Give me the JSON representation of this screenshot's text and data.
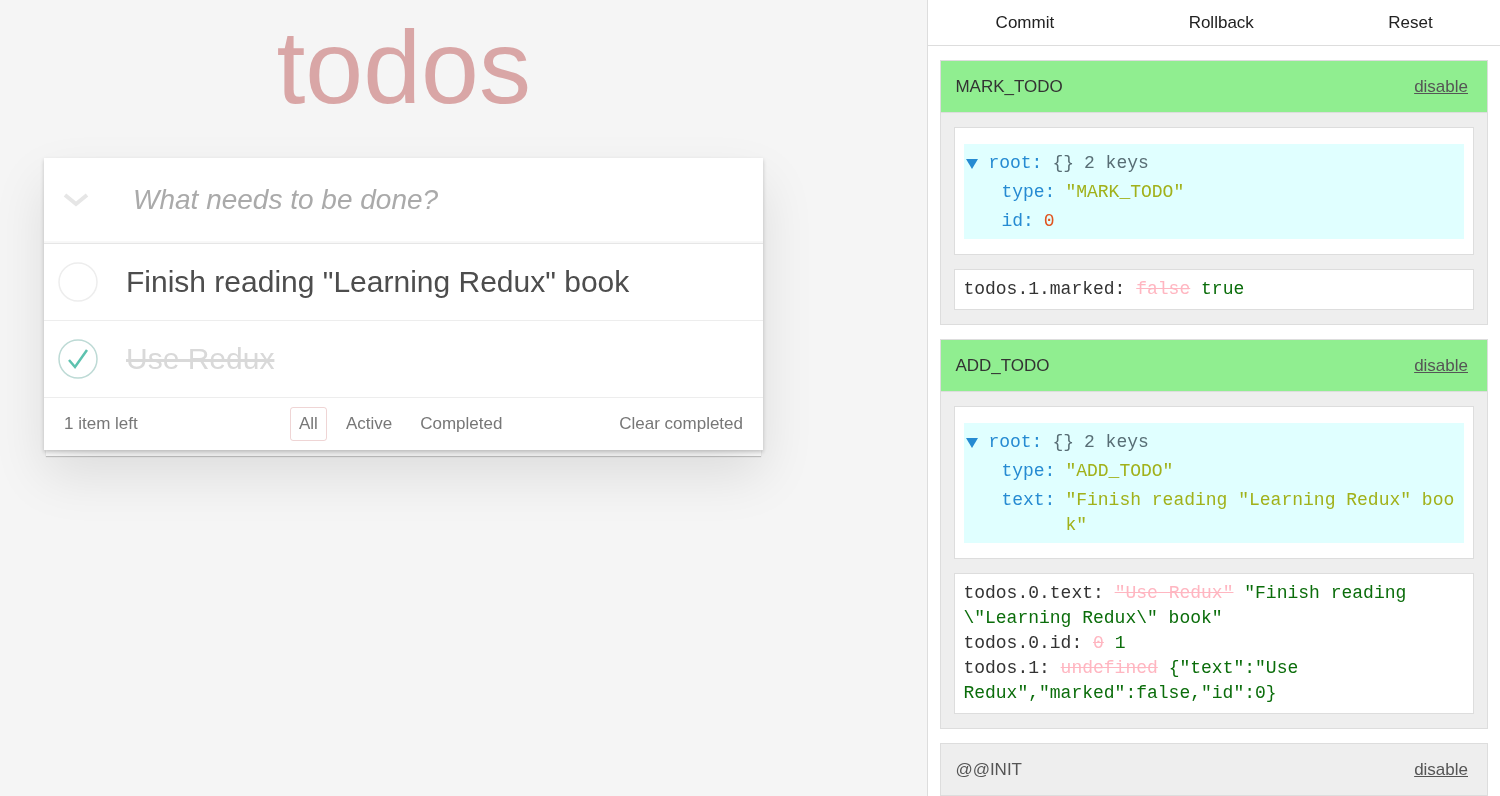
{
  "app": {
    "title": "todos",
    "new_todo": {
      "placeholder": "What needs to be done?"
    },
    "todos": [
      {
        "text": "Finish reading \"Learning Redux\" book",
        "completed": false
      },
      {
        "text": "Use Redux",
        "completed": true
      }
    ],
    "footer": {
      "count": "1 item left",
      "filters": [
        {
          "label": "All",
          "selected": true
        },
        {
          "label": "Active",
          "selected": false
        },
        {
          "label": "Completed",
          "selected": false
        }
      ],
      "clear": "Clear completed"
    }
  },
  "devtools": {
    "buttons": [
      "Commit",
      "Rollback",
      "Reset"
    ],
    "actions": [
      {
        "name": "MARK_TODO",
        "toggle": "disable",
        "highlighted": true,
        "tree": {
          "label": "root:",
          "braces": "{}",
          "summary": "2 keys",
          "expanded": true,
          "fields": [
            {
              "key": "type:",
              "value": "\"MARK_TODO\"",
              "kind": "string"
            },
            {
              "key": "id:",
              "value": "0",
              "kind": "number"
            }
          ]
        },
        "diffs": [
          {
            "path": "todos.1.marked:",
            "old": "false",
            "new": "true"
          }
        ]
      },
      {
        "name": "ADD_TODO",
        "toggle": "disable",
        "highlighted": true,
        "tree": {
          "label": "root:",
          "braces": "{}",
          "summary": "2 keys",
          "expanded": true,
          "fields": [
            {
              "key": "type:",
              "value": "\"ADD_TODO\"",
              "kind": "string"
            },
            {
              "key": "text:",
              "value": "\"Finish reading \"Learning Redux\" book\"",
              "kind": "string"
            }
          ]
        },
        "diffs": [
          {
            "path": "todos.0.text:",
            "old": "\"Use Redux\"",
            "new": "\"Finish reading \\\"Learning Redux\\\" book\""
          },
          {
            "path": "todos.0.id:",
            "old": "0",
            "new": "1"
          },
          {
            "path": "todos.1:",
            "old": "undefined",
            "new": "{\"text\":\"Use Redux\",\"marked\":false,\"id\":0}"
          }
        ]
      },
      {
        "name": "@@INIT",
        "toggle": "disable",
        "highlighted": false
      }
    ]
  }
}
